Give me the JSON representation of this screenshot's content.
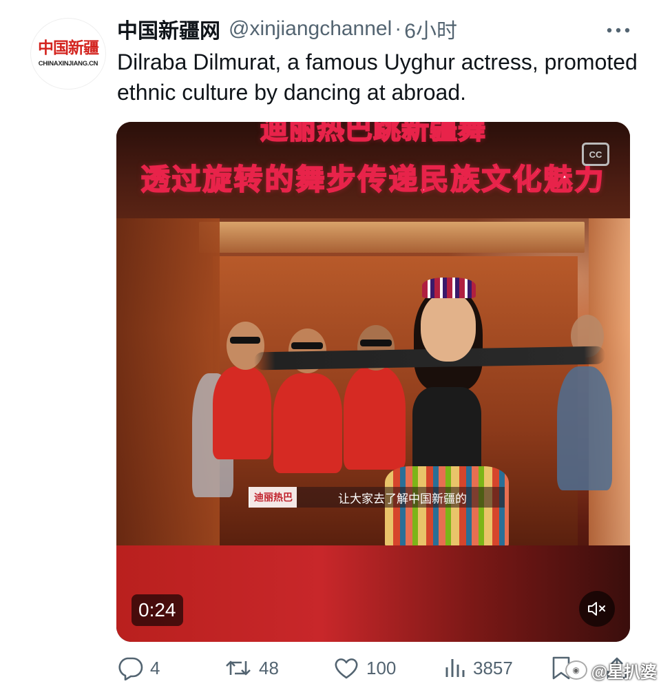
{
  "tweet": {
    "avatar": {
      "logo_text": "中国新疆",
      "domain_text": "CHINAXINJIANG.CN"
    },
    "display_name": "中国新疆网",
    "handle": "@xinjiangchannel",
    "separator": "·",
    "time": "6小时",
    "more_icon": "more-horizontal-icon",
    "text": "Dilraba Dilmurat, a famous Uyghur actress, promoted ethnic culture by dancing at abroad."
  },
  "media": {
    "caption_top": "迪丽热巴跳新疆舞",
    "caption_main": "透过旋转的舞步传递民族文化魅力",
    "cc_label": "CC",
    "subtitle_name": "迪丽热巴",
    "subtitle_text": "让大家去了解中国新疆的",
    "duration": "0:24",
    "mute_icon": "volume-muted-icon"
  },
  "actions": {
    "reply": {
      "icon": "reply-icon",
      "count": "4"
    },
    "retweet": {
      "icon": "retweet-icon",
      "count": "48"
    },
    "like": {
      "icon": "heart-icon",
      "count": "100"
    },
    "views": {
      "icon": "bar-chart-icon",
      "count": "3857"
    },
    "bookmark": {
      "icon": "bookmark-icon"
    },
    "share": {
      "icon": "share-icon"
    }
  },
  "watermark": {
    "text": "@星扒婆"
  },
  "colors": {
    "text_primary": "#0f1419",
    "text_secondary": "#536471",
    "caption_outline": "#e8234a",
    "logo_red": "#d3231e"
  }
}
